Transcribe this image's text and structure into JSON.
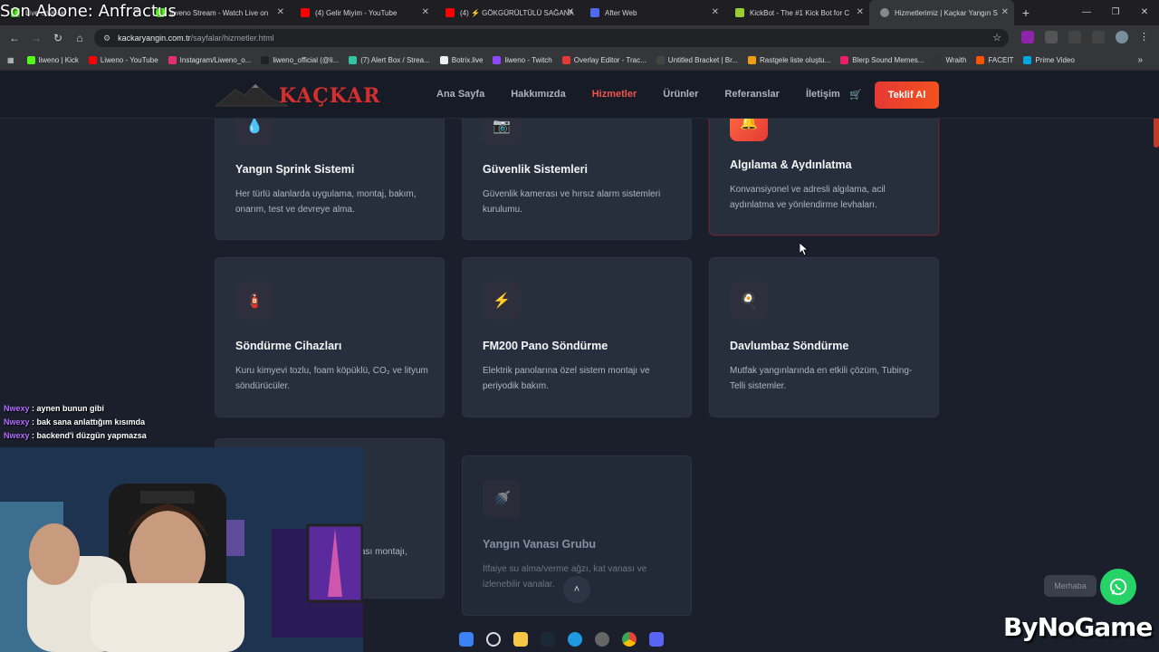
{
  "stream": {
    "overlay_title": "Son Abone: Anfractus",
    "chat": [
      {
        "user": "Nwexy",
        "message": "aynen bunun gibi"
      },
      {
        "user": "Nwexy",
        "message": "bak sana anlattığım kısımda"
      },
      {
        "user": "Nwexy",
        "message": "backend'i düzgün yapmazsa"
      }
    ],
    "watermark": "ByNoGame"
  },
  "browser": {
    "tabs": [
      {
        "label": "Live on Kick",
        "color": "#53fc18",
        "active": false
      },
      {
        "label": "liweno Stream - Watch Live on",
        "color": "#53fc18",
        "active": false
      },
      {
        "label": "(4) Gelir Miyim - YouTube",
        "color": "#ff0000",
        "active": false
      },
      {
        "label": "(4) ⚡ GÖKGÜRÜLTÜLÜ SAĞANA",
        "color": "#ff0000",
        "active": false
      },
      {
        "label": "After Web",
        "color": "#4f6bed",
        "active": false
      },
      {
        "label": "KickBot - The #1 Kick Bot for C",
        "color": "#9acd32",
        "active": false
      },
      {
        "label": "Hizmetlerimiz | Kaçkar Yangın S",
        "color": "#888888",
        "active": true
      }
    ],
    "url_host": "kackaryangin.com.tr",
    "url_path": "/sayfalar/hizmetler.html",
    "bookmarks": [
      {
        "label": "liweno | Kick",
        "color": "#53fc18"
      },
      {
        "label": "Liweno - YouTube",
        "color": "#ff0000"
      },
      {
        "label": "Instagram/Liweno_o...",
        "color": "#e1306c"
      },
      {
        "label": "liweno_official (@li...",
        "color": "#222222"
      },
      {
        "label": "(7) Alert Box / Strea...",
        "color": "#31c3a2"
      },
      {
        "label": "Botrix.live",
        "color": "#eeeeee"
      },
      {
        "label": "liweno - Twitch",
        "color": "#9146ff"
      },
      {
        "label": "Overlay Editor - Trac...",
        "color": "#e53935"
      },
      {
        "label": "Untitled Bracket | Br...",
        "color": "#444444"
      },
      {
        "label": "Rastgele liste oluştu...",
        "color": "#f39c12"
      },
      {
        "label": "Blerp Sound Memes...",
        "color": "#e91e63"
      },
      {
        "label": "Wraith",
        "color": "#333333"
      },
      {
        "label": "FACEIT",
        "color": "#ff5500"
      },
      {
        "label": "Prime Video",
        "color": "#00a8e1"
      }
    ]
  },
  "site": {
    "logo": "KAÇKAR",
    "nav": [
      "Ana Sayfa",
      "Hakkımızda",
      "Hizmetler",
      "Ürünler",
      "Referanslar",
      "İletişim"
    ],
    "active_nav": "Hizmetler",
    "cta": "Teklif Al",
    "whatsapp_bubble": "Merhaba",
    "scroll_top": "˄",
    "cards": [
      {
        "icon": "💧",
        "title": "Yangın Sprink Sistemi",
        "desc": "Her türlü alanlarda uygulama, montaj, bakım, onarım, test ve devreye alma."
      },
      {
        "icon": "📷",
        "title": "Güvenlik Sistemleri",
        "desc": "Güvenlik kamerası ve hırsız alarm sistemleri kurulumu."
      },
      {
        "icon": "🔔",
        "title": "Algılama & Aydınlatma",
        "desc": "Konvansiyonel ve adresli algılama, acil aydınlatma ve yönlendirme levhaları."
      },
      {
        "icon": "🧯",
        "title": "Söndürme Cihazları",
        "desc": "Kuru kimyevi tozlu, foam köpüklü, CO₂ ve lityum söndürücüler."
      },
      {
        "icon": "⚡",
        "title": "FM200 Pano Söndürme",
        "desc": "Elektrik panolarına özel sistem montajı ve periyodik bakım."
      },
      {
        "icon": "🍳",
        "title": "Davlumbaz Söndürme",
        "desc": "Mutfak yangınlarında en etkili çözüm, Tubing-Telli sistemler."
      },
      {
        "icon": "",
        "title": "",
        "desc": "ası montajı,"
      },
      {
        "icon": "🚿",
        "title": "Yangın Vanası Grubu",
        "desc": "İtfaiye su alma/verme ağzı, kat vanası ve izlenebilir vanalar."
      }
    ]
  },
  "taskbar": {
    "icons": [
      "windows-icon",
      "search-icon",
      "explorer-icon",
      "steam-icon",
      "edge-icon",
      "app-icon",
      "chrome-icon",
      "discord-icon"
    ]
  }
}
